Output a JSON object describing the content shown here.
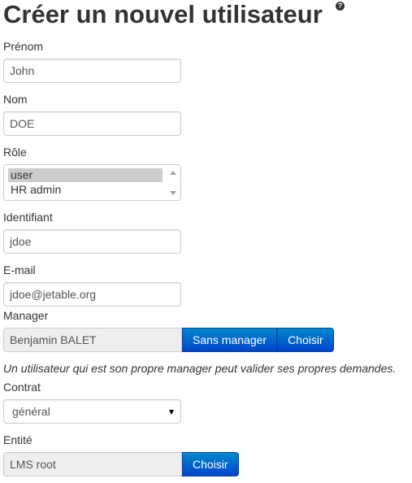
{
  "page": {
    "title": "Créer un nouvel utilisateur",
    "help_glyph": "?"
  },
  "form": {
    "firstname": {
      "label": "Prénom",
      "value": "John"
    },
    "lastname": {
      "label": "Nom",
      "value": "DOE"
    },
    "role": {
      "label": "Rôle",
      "options": [
        "user",
        "HR admin"
      ],
      "selected": "user"
    },
    "login": {
      "label": "Identifiant",
      "value": "jdoe"
    },
    "email": {
      "label": "E-mail",
      "value": "jdoe@jetable.org"
    },
    "manager": {
      "label": "Manager",
      "value": "Benjamin BALET",
      "no_manager_button": "Sans manager",
      "choose_button": "Choisir",
      "note": "Un utilisateur qui est son propre manager peut valider ses propres demandes."
    },
    "contract": {
      "label": "Contrat",
      "value": "général"
    },
    "entity": {
      "label": "Entité",
      "value": "LMS root",
      "choose_button": "Choisir"
    }
  },
  "colors": {
    "primary_button": "#0062cc",
    "readonly_bg": "#eeeeee",
    "selected_option": "#cccccc"
  }
}
